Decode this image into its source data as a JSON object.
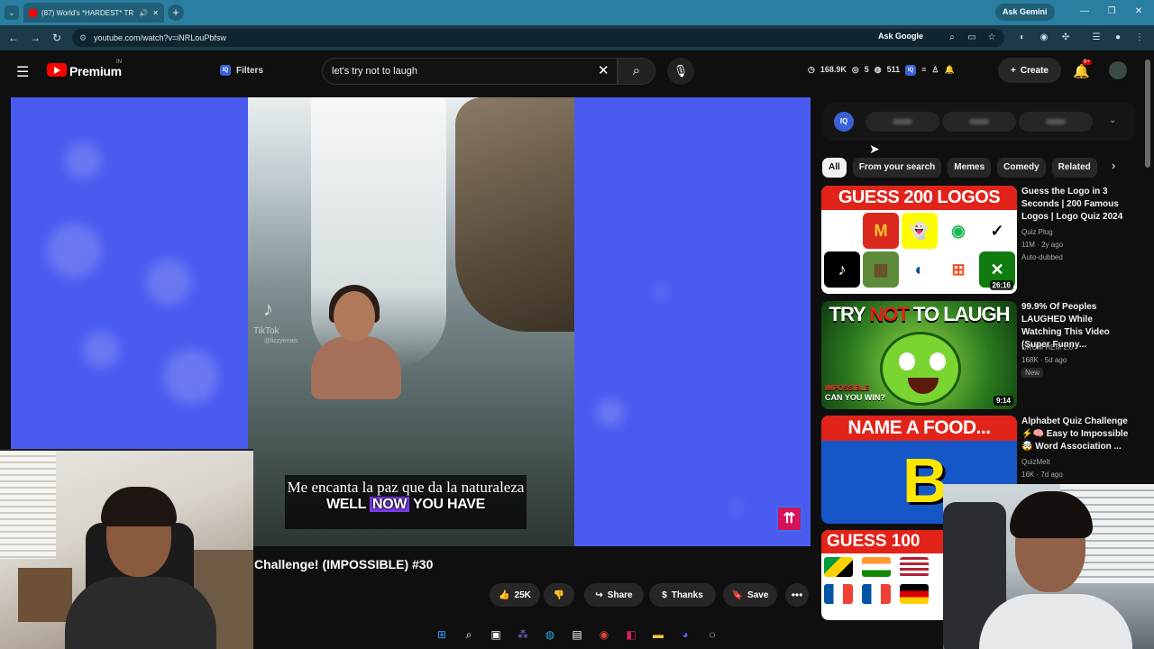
{
  "browser": {
    "tab_title": "(87) World's *HARDEST* TR",
    "url": "youtube.com/watch?v=iNRLouPbfsw",
    "ask_gemini": "Ask Gemini",
    "ask_google": "Ask Google"
  },
  "header": {
    "logo_text": "Premium",
    "region": "IN",
    "filters_label": "Filters",
    "iq_badge": "IQ",
    "search_value": "let's try not to laugh",
    "stats": [
      "168.9K",
      "5",
      "511"
    ],
    "create_label": "Create",
    "notif_count": "9+"
  },
  "player": {
    "tiktok_label": "TikTok",
    "tiktok_handle": "@lizzyenais",
    "subtitle_es": "Me encanta la paz que da la naturaleza",
    "subtitle_en_pre": "WELL",
    "subtitle_en_hl": "NOW",
    "subtitle_en_post": "YOU HAVE"
  },
  "video": {
    "title": "Challenge! (IMPOSSIBLE) #30",
    "likes": "25K",
    "share": "Share",
    "thanks": "Thanks",
    "save": "Save"
  },
  "sidebar": {
    "iq_logo": "IQ",
    "chips": [
      "All",
      "From your search",
      "Memes",
      "Comedy",
      "Related"
    ],
    "recs": [
      {
        "title": "Guess the Logo in 3 Seconds | 200 Famous Logos | Logo Quiz 2024",
        "channel": "Quiz Plug",
        "meta": "11M · 2y ago",
        "tag": "Auto-dubbed",
        "duration": "26:16",
        "thumb_text": "GUESS 200 LOGOS"
      },
      {
        "title": "99.9% Of Peoples LAUGHED While Watching This Video (Super Funny...",
        "channel": "DRUM HEM 2.0",
        "meta": "168K · 5d ago",
        "tag": "New",
        "duration": "9:14",
        "thumb_text_1": "TRY",
        "thumb_text_2": "NOT",
        "thumb_text_3": "TO LAUGH",
        "thumb_impossible": "IMPOSSIBLE",
        "thumb_can": "CAN YOU WIN?"
      },
      {
        "title": "Alphabet Quiz Challenge ⚡🧠 Easy to Impossible 🤯 Word Association ...",
        "channel": "QuizMelt",
        "meta": "16K · 7d ago",
        "thumb_text": "NAME A FOOD...",
        "thumb_letter": "B"
      },
      {
        "thumb_text": "GUESS 100"
      }
    ]
  },
  "colors": {
    "brand_red": "#ff0000",
    "player_bg": "#4a5cf0",
    "highlight": "#7b3cf0"
  }
}
